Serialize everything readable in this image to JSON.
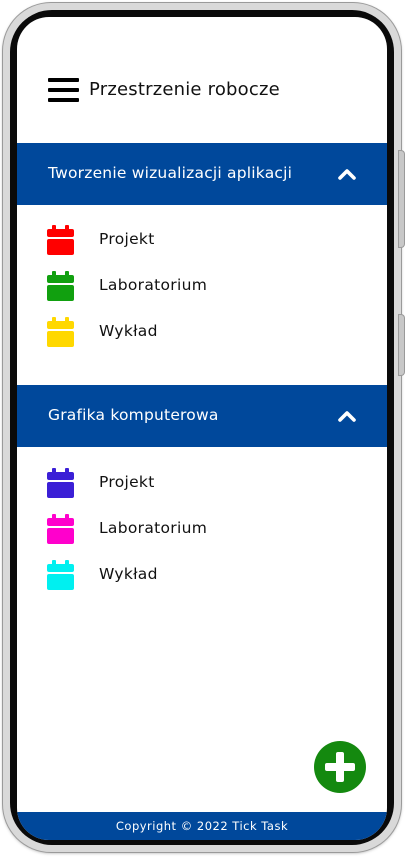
{
  "colors": {
    "primary": "#00489b",
    "fab": "#14890f",
    "text": "#111111"
  },
  "header": {
    "title": "Przestrzenie robocze",
    "menu_icon": "hamburger-menu-icon"
  },
  "workspaces": [
    {
      "title": "Tworzenie wizualizacji aplikacji",
      "expanded": true,
      "items": [
        {
          "label": "Projekt",
          "icon": "calendar-icon",
          "color": "#ff0000"
        },
        {
          "label": "Laboratorium",
          "icon": "calendar-icon",
          "color": "#11a00f"
        },
        {
          "label": "Wykład",
          "icon": "calendar-icon",
          "color": "#ffd800"
        }
      ]
    },
    {
      "title": "Grafika komputerowa",
      "expanded": true,
      "items": [
        {
          "label": "Projekt",
          "icon": "calendar-icon",
          "color": "#3b1fd6"
        },
        {
          "label": "Laboratorium",
          "icon": "calendar-icon",
          "color": "#ff00cc"
        },
        {
          "label": "Wykład",
          "icon": "calendar-icon",
          "color": "#00f0f0"
        }
      ]
    }
  ],
  "fab": {
    "icon": "plus-icon"
  },
  "footer": {
    "text": "Copyright © 2022 Tick Task"
  }
}
